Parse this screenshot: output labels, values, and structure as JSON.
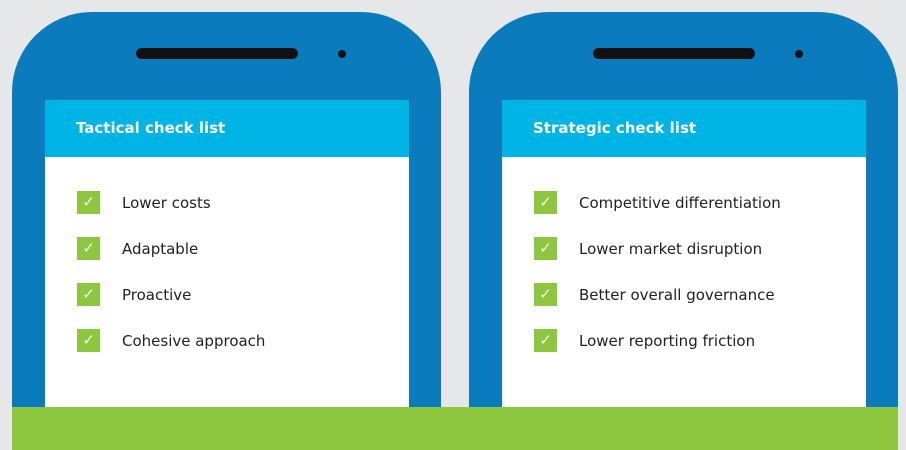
{
  "colors": {
    "background": "#e6e7e8",
    "phone_body": "#0a7bbd",
    "screen_header": "#00b5e6",
    "check_green": "#8dc63f",
    "band_green": "#8dc63f"
  },
  "icons": {
    "check": "✓"
  },
  "tactical": {
    "title": "Tactical check list",
    "items": [
      {
        "label": "Lower costs"
      },
      {
        "label": "Adaptable"
      },
      {
        "label": "Proactive"
      },
      {
        "label": "Cohesive approach"
      }
    ]
  },
  "strategic": {
    "title": "Strategic check list",
    "items": [
      {
        "label": "Competitive differentiation"
      },
      {
        "label": "Lower market disruption"
      },
      {
        "label": "Better overall governance"
      },
      {
        "label": "Lower reporting friction"
      }
    ]
  }
}
